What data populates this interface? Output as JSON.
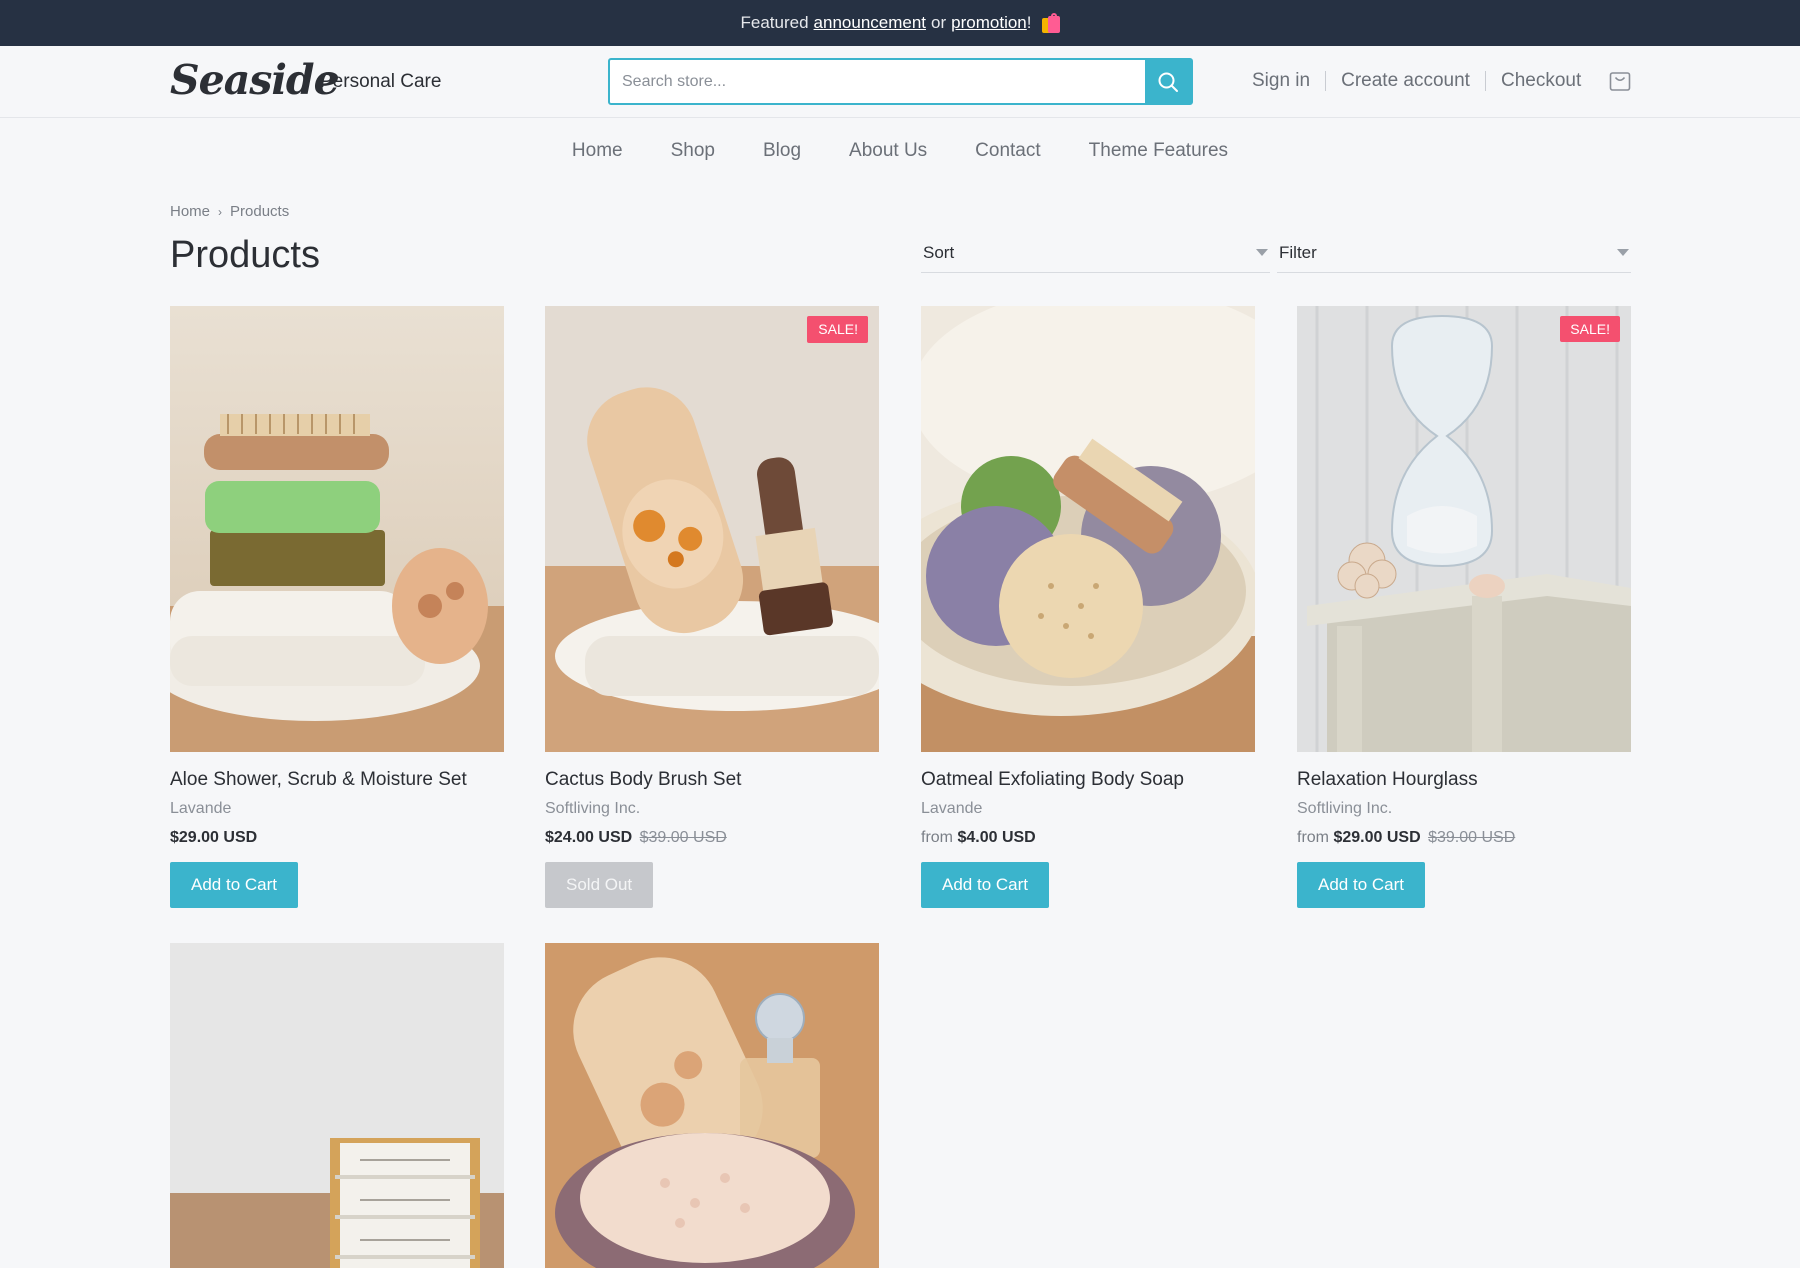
{
  "announcement": {
    "prefix": "Featured",
    "link1": "announcement",
    "middle": "or",
    "link2": "promotion",
    "suffix": "!"
  },
  "header": {
    "logo": "Seaside",
    "store_name": "Personal Care",
    "search_placeholder": "Search store...",
    "sign_in": "Sign in",
    "create_account": "Create account",
    "checkout": "Checkout"
  },
  "nav": {
    "items": [
      "Home",
      "Shop",
      "Blog",
      "About Us",
      "Contact",
      "Theme Features"
    ]
  },
  "breadcrumb": {
    "home": "Home",
    "current": "Products"
  },
  "page": {
    "title": "Products",
    "sort_label": "Sort",
    "filter_label": "Filter"
  },
  "products": [
    {
      "name": "Aloe Shower, Scrub & Moisture Set",
      "vendor": "Lavande",
      "price_prefix": "",
      "price": "$29.00 USD",
      "compare_price": "",
      "badge": "",
      "button": "Add to Cart",
      "sold_out": false
    },
    {
      "name": "Cactus Body Brush Set",
      "vendor": "Softliving Inc.",
      "price_prefix": "",
      "price": "$24.00 USD",
      "compare_price": "$39.00 USD",
      "badge": "SALE!",
      "button": "Sold Out",
      "sold_out": true
    },
    {
      "name": "Oatmeal Exfoliating Body Soap",
      "vendor": "Lavande",
      "price_prefix": "from",
      "price": "$4.00 USD",
      "compare_price": "",
      "badge": "",
      "button": "Add to Cart",
      "sold_out": false
    },
    {
      "name": "Relaxation Hourglass",
      "vendor": "Softliving Inc.",
      "price_prefix": "from",
      "price": "$29.00 USD",
      "compare_price": "$39.00 USD",
      "badge": "SALE!",
      "button": "Add to Cart",
      "sold_out": false
    }
  ],
  "colors": {
    "accent": "#3bb4cc",
    "sale_badge": "#f4506f",
    "topbar": "#263143",
    "background": "#f6f7f9"
  }
}
